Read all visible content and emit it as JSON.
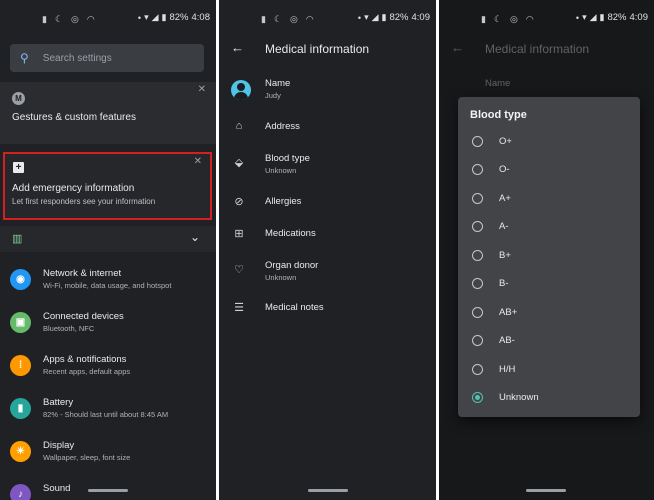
{
  "status": [
    {
      "time": "4:08",
      "battery": "82%"
    },
    {
      "time": "4:09",
      "battery": "82%"
    },
    {
      "time": "4:09",
      "battery": "82%"
    }
  ],
  "settings": {
    "search": {
      "placeholder": "Search settings"
    },
    "gestures_card": {
      "title": "Gestures & custom features"
    },
    "emergency_card": {
      "title": "Add emergency information",
      "subtitle": "Let first responders see your information"
    },
    "items": [
      {
        "title": "Network & internet",
        "subtitle": "Wi-Fi, mobile, data usage, and hotspot",
        "icon": "wifi-icon",
        "color": "#2196f3"
      },
      {
        "title": "Connected devices",
        "subtitle": "Bluetooth, NFC",
        "icon": "devices-icon",
        "color": "#66bb6a"
      },
      {
        "title": "Apps & notifications",
        "subtitle": "Recent apps, default apps",
        "icon": "apps-icon",
        "color": "#ff9800"
      },
      {
        "title": "Battery",
        "subtitle": "82% - Should last until about 8:45 AM",
        "icon": "battery-icon",
        "color": "#26a69a"
      },
      {
        "title": "Display",
        "subtitle": "Wallpaper, sleep, font size",
        "icon": "display-icon",
        "color": "#ffa000"
      },
      {
        "title": "Sound",
        "subtitle": "",
        "icon": "sound-icon",
        "color": "#7e57c2"
      }
    ]
  },
  "medical": {
    "title": "Medical information",
    "items": [
      {
        "title": "Name",
        "value": "Judy",
        "icon": "person-icon"
      },
      {
        "title": "Address",
        "value": "",
        "icon": "home-icon"
      },
      {
        "title": "Blood type",
        "value": "Unknown",
        "icon": "blood-drop-icon"
      },
      {
        "title": "Allergies",
        "value": "",
        "icon": "no-entry-icon"
      },
      {
        "title": "Medications",
        "value": "",
        "icon": "medication-icon"
      },
      {
        "title": "Organ donor",
        "value": "Unknown",
        "icon": "heart-icon"
      },
      {
        "title": "Medical notes",
        "value": "",
        "icon": "notes-icon"
      }
    ]
  },
  "dialog": {
    "title": "Blood type",
    "options": [
      "O+",
      "O-",
      "A+",
      "A-",
      "B+",
      "B-",
      "AB+",
      "AB-",
      "H/H",
      "Unknown"
    ],
    "selected": "Unknown"
  },
  "accent": "#4fc3b3"
}
